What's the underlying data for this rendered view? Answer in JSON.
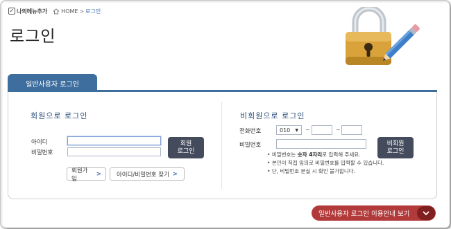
{
  "header": {
    "my_menu_label": "나의메뉴추가",
    "breadcrumb_home": "HOME",
    "breadcrumb_sep": ">",
    "breadcrumb_current": "로그인"
  },
  "page_title": "로그인",
  "tabs": [
    {
      "label": "일반사용자 로그인"
    }
  ],
  "member_login": {
    "title": "회원으로 로그인",
    "id_label": "아이디",
    "password_label": "비밀번호",
    "id_value": "",
    "password_value": "",
    "login_button_line1": "회원",
    "login_button_line2": "로그인",
    "signup_label": "회원가입",
    "find_label": "아이디/비밀번호 찾기",
    "arrow": ">"
  },
  "guest_login": {
    "title": "비회원으로 로그인",
    "phone_label": "전화번호",
    "phone_prefix": "010",
    "phone_mid": "",
    "phone_last": "",
    "tilde": "~",
    "password_label": "비밀번호",
    "password_value": "",
    "login_button_line1": "비회원",
    "login_button_line2": "로그인",
    "notes": [
      {
        "pre": "비밀번호는 ",
        "bold": "숫자 4자리",
        "post": "로 입력해 주세요."
      },
      {
        "pre": "본인이 직접 임의로 비밀번호를 입력할 수 있습니다.",
        "bold": "",
        "post": ""
      },
      {
        "pre": "단, 비밀번호 분실 시 확인 불가합니다.",
        "bold": "",
        "post": ""
      }
    ]
  },
  "guide_button_label": "일반사용자 로그인 이용안내 보기",
  "colors": {
    "tab_blue": "#3e6e9e",
    "dark_button": "#444b5c",
    "guide_red": "#b23a3a",
    "title_blue": "#2d4f7a"
  },
  "icons": [
    "check-icon",
    "home-icon",
    "lock-pencil-icon",
    "chevron-down-icon",
    "dropdown-caret-icon"
  ]
}
